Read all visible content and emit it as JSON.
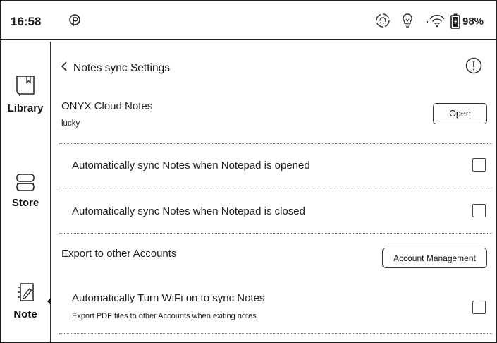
{
  "status_bar": {
    "time": "16:58",
    "battery_percent": "98%",
    "icons": [
      "p-logo-icon",
      "sync-icon",
      "lightbulb-icon",
      "wifi-icon",
      "battery-icon"
    ]
  },
  "sidebar": {
    "items": [
      {
        "label": "Library",
        "icon": "book-icon"
      },
      {
        "label": "Store",
        "icon": "store-icon"
      },
      {
        "label": "Note",
        "icon": "pen-note-icon"
      }
    ],
    "active": "Note"
  },
  "header": {
    "title": "Notes sync Settings",
    "info_icon": "info-icon"
  },
  "cloud": {
    "title": "ONYX Cloud Notes",
    "account": "lucky",
    "open_label": "Open"
  },
  "settings": [
    {
      "label": "Automatically sync Notes when Notepad is opened",
      "checked": false
    },
    {
      "label": "Automatically sync Notes when Notepad is closed",
      "checked": false
    }
  ],
  "export": {
    "title": "Export to other Accounts",
    "button_label": "Account Management"
  },
  "wifi_setting": {
    "label": "Automatically Turn WiFi on to sync Notes",
    "description": "Export PDF files to other Accounts when exiting notes",
    "checked": false
  }
}
